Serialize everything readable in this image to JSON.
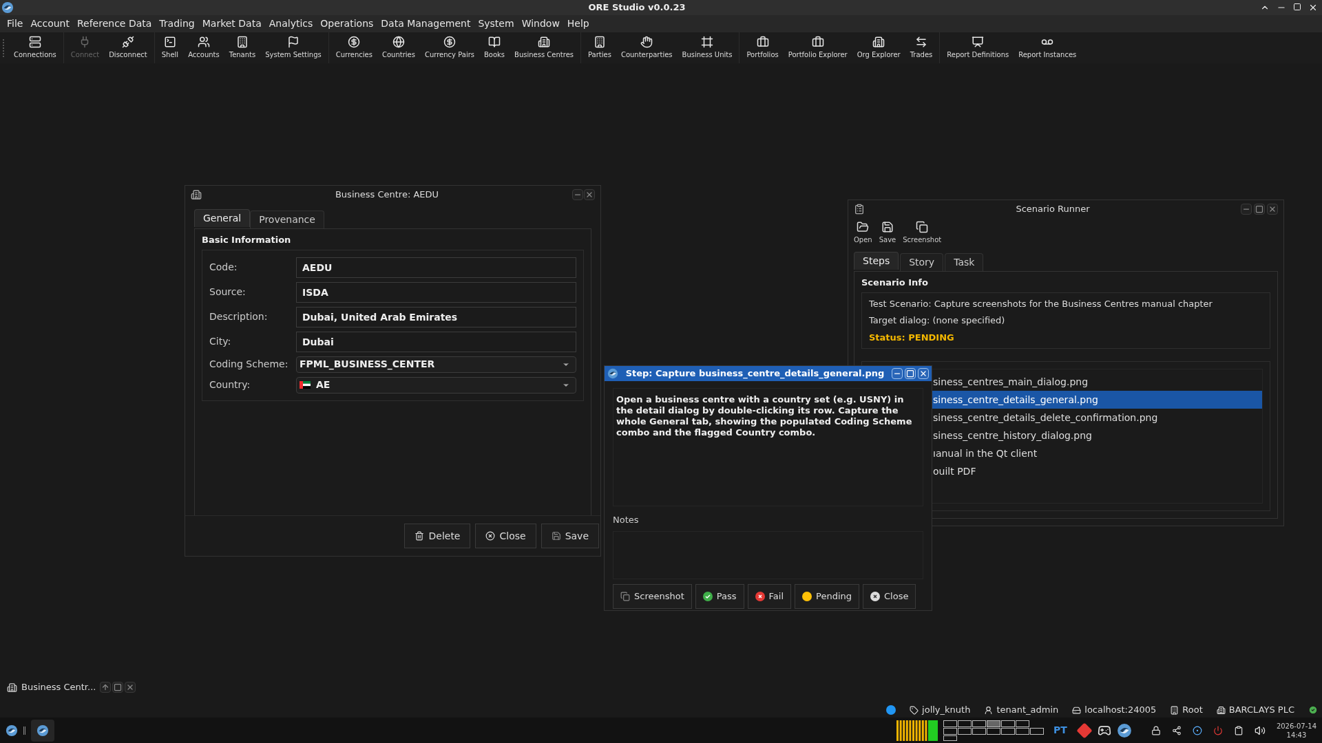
{
  "app": {
    "title": "ORE Studio v0.0.23"
  },
  "menu": [
    {
      "label": "File"
    },
    {
      "label": "Account"
    },
    {
      "label": "Reference Data"
    },
    {
      "label": "Trading"
    },
    {
      "label": "Market Data"
    },
    {
      "label": "Analytics"
    },
    {
      "label": "Operations"
    },
    {
      "label": "Data Management"
    },
    {
      "label": "System"
    },
    {
      "label": "Window"
    },
    {
      "label": "Help"
    }
  ],
  "toolbar": {
    "groups": [
      [
        {
          "label": "Connections",
          "disabled": false
        }
      ],
      [
        {
          "label": "Connect",
          "disabled": true
        },
        {
          "label": "Disconnect",
          "disabled": false
        }
      ],
      [
        {
          "label": "Shell",
          "disabled": false
        },
        {
          "label": "Accounts",
          "disabled": false
        },
        {
          "label": "Tenants",
          "disabled": false
        },
        {
          "label": "System Settings",
          "disabled": false
        }
      ],
      [
        {
          "label": "Currencies",
          "disabled": false
        },
        {
          "label": "Countries",
          "disabled": false
        },
        {
          "label": "Currency Pairs",
          "disabled": false
        },
        {
          "label": "Books",
          "disabled": false
        },
        {
          "label": "Business Centres",
          "disabled": false
        }
      ],
      [
        {
          "label": "Parties",
          "disabled": false
        },
        {
          "label": "Counterparties",
          "disabled": false
        },
        {
          "label": "Business Units",
          "disabled": false
        }
      ],
      [
        {
          "label": "Portfolios",
          "disabled": false
        },
        {
          "label": "Portfolio Explorer",
          "disabled": false
        },
        {
          "label": "Org Explorer",
          "disabled": false
        },
        {
          "label": "Trades",
          "disabled": false
        }
      ],
      [
        {
          "label": "Report Definitions",
          "disabled": false
        },
        {
          "label": "Report Instances",
          "disabled": false
        }
      ]
    ]
  },
  "business_centre_window": {
    "title": "Business Centre: AEDU",
    "tabs": [
      {
        "label": "General",
        "selected": true
      },
      {
        "label": "Provenance",
        "selected": false
      }
    ],
    "group_title": "Basic Information",
    "fields": [
      {
        "label": "Code:",
        "value": "AEDU",
        "kind": "text"
      },
      {
        "label": "Source:",
        "value": "ISDA",
        "kind": "text"
      },
      {
        "label": "Description:",
        "value": "Dubai, United Arab Emirates",
        "kind": "text"
      },
      {
        "label": "City:",
        "value": "Dubai",
        "kind": "text"
      },
      {
        "label": "Coding Scheme:",
        "value": "FPML_BUSINESS_CENTER",
        "kind": "combo"
      },
      {
        "label": "Country:",
        "value": "AE",
        "kind": "country"
      }
    ],
    "buttons": [
      {
        "label": "Delete",
        "kind": "delete"
      },
      {
        "label": "Close",
        "kind": "close"
      },
      {
        "label": "Save",
        "kind": "save"
      }
    ]
  },
  "scenario_runner": {
    "title": "Scenario Runner",
    "toolbar": [
      {
        "label": "Open"
      },
      {
        "label": "Save"
      },
      {
        "label": "Screenshot"
      }
    ],
    "tabs": [
      {
        "label": "Steps",
        "selected": true
      },
      {
        "label": "Story",
        "selected": false
      },
      {
        "label": "Task",
        "selected": false
      }
    ],
    "info_title": "Scenario Info",
    "info_lines": [
      {
        "text": "Test Scenario: Capture screenshots for the Business Centres manual chapter",
        "kind": "plain"
      },
      {
        "text": "Target dialog: (none specified)",
        "kind": "plain"
      },
      {
        "text": "Status: PENDING",
        "kind": "status"
      }
    ],
    "steps": [
      {
        "label": "siness_centres_main_dialog.png",
        "selected": false
      },
      {
        "label": "siness_centre_details_general.png",
        "selected": true
      },
      {
        "label": "siness_centre_details_delete_confirmation.png",
        "selected": false
      },
      {
        "label": "siness_centre_history_dialog.png",
        "selected": false
      },
      {
        "label": "ıanual in the Qt client",
        "selected": false
      },
      {
        "label": "ouilt PDF",
        "selected": false
      }
    ]
  },
  "step_dialog": {
    "title": "Step: Capture business_centre_details_general.png",
    "description": "Open a business centre with a country set (e.g. USNY) in the detail dialog by double-clicking its row. Capture the whole General tab, showing the populated Coding Scheme combo and the flagged Country combo.",
    "notes_label": "Notes",
    "buttons": [
      {
        "label": "Screenshot",
        "kind": "screenshot"
      },
      {
        "label": "Pass",
        "kind": "pass"
      },
      {
        "label": "Fail",
        "kind": "fail"
      },
      {
        "label": "Pending",
        "kind": "pending"
      },
      {
        "label": "Close",
        "kind": "close"
      }
    ]
  },
  "minimized_window": {
    "title": "Business Centr..."
  },
  "status_bar": [
    {
      "label": "jolly_knuth"
    },
    {
      "label": "tenant_admin"
    },
    {
      "label": "localhost:24005"
    },
    {
      "label": "Root"
    },
    {
      "label": "BARCLAYS PLC"
    }
  ],
  "taskbar": {
    "keyboard_layout": "PT",
    "date": "2026-07-14",
    "time": "14:43"
  }
}
